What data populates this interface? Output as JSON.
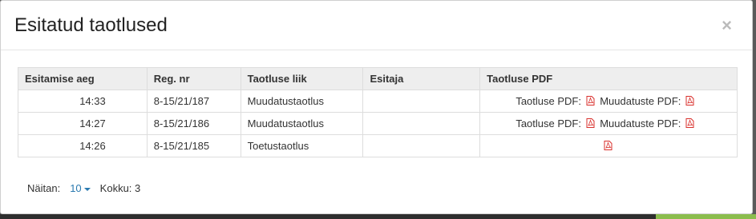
{
  "dialog": {
    "title": "Esitatud taotlused",
    "close_glyph": "×"
  },
  "table": {
    "columns": [
      "Esitamise aeg",
      "Reg. nr",
      "Taotluse liik",
      "Esitaja",
      "Taotluse PDF"
    ],
    "rows": [
      {
        "time": "14:33",
        "reg_nr": "8-15/21/187",
        "type": "Muudatustaotlus",
        "submitter": "",
        "pdf_label": "Taotluse PDF:",
        "changes_label": "Muudatuste PDF:"
      },
      {
        "time": "14:27",
        "reg_nr": "8-15/21/186",
        "type": "Muudatustaotlus",
        "submitter": "",
        "pdf_label": "Taotluse PDF:",
        "changes_label": "Muudatuste PDF:"
      },
      {
        "time": "14:26",
        "reg_nr": "8-15/21/185",
        "type": "Toetustaotlus",
        "submitter": ""
      }
    ]
  },
  "pager": {
    "showing_label": "Näitan:",
    "page_size": "10",
    "total_label": "Kokku: 3"
  },
  "colors": {
    "pdf_icon": "#d9302c",
    "link": "#2a7ab0",
    "header_bg": "#eeeeee"
  },
  "icons": {
    "pdf": "pdf-file-icon",
    "close": "close-icon",
    "dropdown": "caret-down-icon"
  }
}
